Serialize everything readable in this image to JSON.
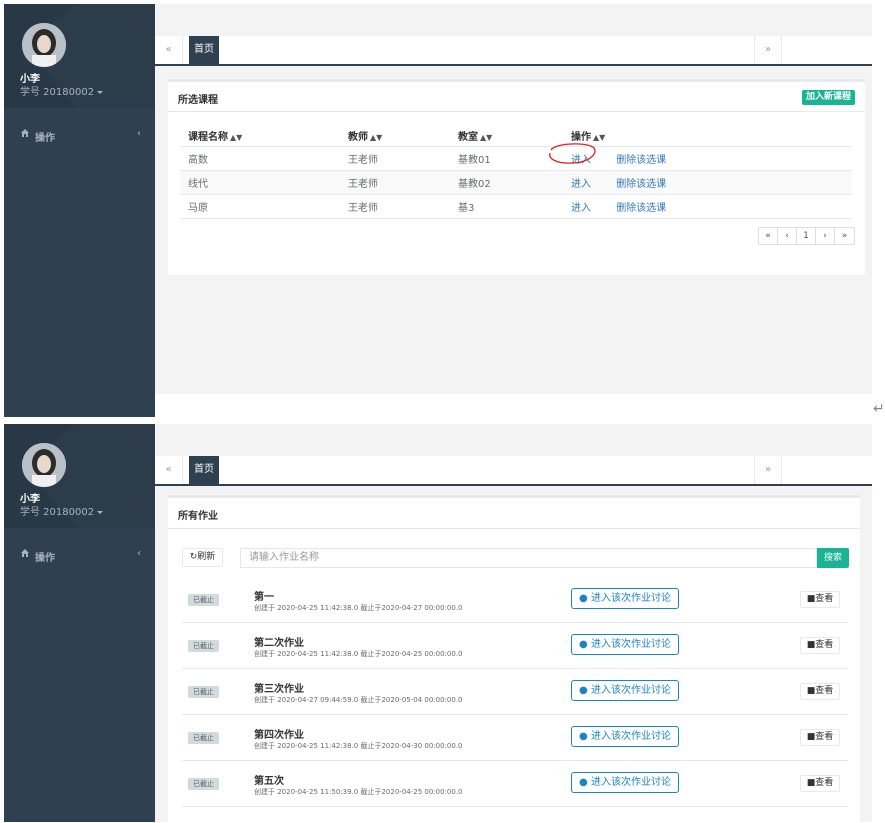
{
  "app": {
    "user_name": "小李",
    "user_id": "学号 20180002",
    "nav_label": "操作",
    "tab_prev": "«",
    "tab_home": "首页",
    "tab_next": "»",
    "nav_chevron": "‹"
  },
  "courses": {
    "title": "所选课程",
    "add_button": "加入新课程",
    "headers": [
      "课程名称",
      "教师",
      "教室",
      "操作"
    ],
    "rows": [
      {
        "name": "高数",
        "teacher": "王老师",
        "room": "基教01",
        "enter": "进入",
        "delete": "删除该选课"
      },
      {
        "name": "线代",
        "teacher": "王老师",
        "room": "基教02",
        "enter": "进入",
        "delete": "删除该选课"
      },
      {
        "name": "马原",
        "teacher": "王老师",
        "room": "基3",
        "enter": "进入",
        "delete": "删除该选课"
      }
    ],
    "pager": [
      "«",
      "‹",
      "1",
      "›",
      "»"
    ]
  },
  "homework": {
    "title": "所有作业",
    "refresh_label": "刷新",
    "search_placeholder": "请输入作业名称",
    "search_button": "搜索",
    "items": [
      {
        "status": "已截止",
        "title": "第一",
        "meta": "创建于 2020-04-25 11:42:38.0 截止于2020-04-27 00:00:00.0",
        "discuss": "进入该次作业讨论",
        "view": "查看"
      },
      {
        "status": "已截止",
        "title": "第二次作业",
        "meta": "创建于 2020-04-25 11:42:38.0 截止于2020-04-25 00:00:00.0",
        "discuss": "进入该次作业讨论",
        "view": "查看"
      },
      {
        "status": "已截止",
        "title": "第三次作业",
        "meta": "创建于 2020-04-27 09:44:59.0 截止于2020-05-04 00:00:00.0",
        "discuss": "进入该次作业讨论",
        "view": "查看"
      },
      {
        "status": "已截止",
        "title": "第四次作业",
        "meta": "创建于 2020-04-25 11:42:38.0 截止于2020-04-30 00:00:00.0",
        "discuss": "进入该次作业讨论",
        "view": "查看"
      },
      {
        "status": "已截止",
        "title": "第五次",
        "meta": "创建于 2020-04-25 11:50:39.0 截止于2020-04-25 00:00:00.0",
        "discuss": "进入该次作业讨论",
        "view": "查看"
      }
    ]
  },
  "annotation_color": "#e02020",
  "accent_color": "#1ab394"
}
